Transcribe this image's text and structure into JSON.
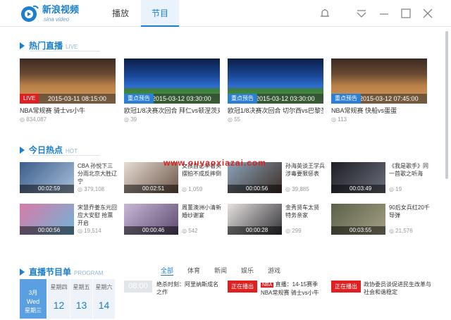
{
  "app": {
    "name": "新浪视频",
    "name_en": "sina video"
  },
  "tabs": [
    {
      "label": "播放"
    },
    {
      "label": "节目"
    }
  ],
  "live": {
    "title": "热门直播",
    "title_en": "LIVE",
    "cards": [
      {
        "badge": "LIVE",
        "time": "2015-03-11 08:15:00",
        "title": "NBA常规赛 骑士vs小牛",
        "count": "834,087"
      },
      {
        "badge": "重点预告",
        "time": "2015-03-12 03:30:00",
        "title": "欧冠1/8决赛次回合 拜仁vs顿涅茨克",
        "count": "39"
      },
      {
        "badge": "重点预告",
        "time": "2015-03-12 03:30:00",
        "title": "欧冠1/8决赛次回合 切尔西vs巴黎圣",
        "count": "55"
      },
      {
        "badge": "重点预告",
        "time": "2015-03-12 07:45:00",
        "title": "NBA常规赛 快船vs蛋蛋",
        "count": "113"
      }
    ]
  },
  "hot": {
    "title": "今日热点",
    "title_en": "HOT",
    "items": [
      {
        "duration": "00:02:59",
        "text": "CBA 孙悦下三分雨北京大胜辽宁",
        "count": "379,108"
      },
      {
        "duration": "00:02:51",
        "text": "女孩自己举着头摆拍不成反摔倒",
        "count": "1,059"
      },
      {
        "duration": "00:00:56",
        "text": "孙海英谈王学兵涉毒要狠惩表",
        "count": "39,885"
      },
      {
        "duration": "00:03:49",
        "text": "《我是歌手》同一首歌之听海",
        "count": "19"
      },
      {
        "duration": "00:00:56",
        "text": "宋慧乔姜东元回应大安慰 抢票开启",
        "count": "19,514"
      },
      {
        "duration": "00:00:46",
        "text": "周董澳洲小清新婚纱谢宴",
        "count": "542"
      },
      {
        "duration": "00:00:28",
        "text": "金秀贤车太贤 特务亲家",
        "count": "299"
      },
      {
        "duration": "00:03:55",
        "text": "90后女兵红20千导弹",
        "count": "21,576"
      }
    ]
  },
  "schedule": {
    "title": "直播节目单",
    "title_en": "PROGRAM",
    "month": "3月",
    "weekday_en": "Wed",
    "weekday": "星期三",
    "days": [
      {
        "name": "星期四",
        "num": "12"
      },
      {
        "name": "星期五",
        "num": "13"
      },
      {
        "name": "星期六",
        "num": "14"
      }
    ],
    "filters": [
      "全部",
      "体育",
      "新闻",
      "娱乐",
      "游戏"
    ],
    "time": "08:00",
    "programs": [
      {
        "text": "绝杀时刻：阿里纳斯成名之作"
      },
      {
        "onair": "正在播出",
        "tag": "NBA",
        "text": "直播：14-15赛季 NBA常规赛 骑士vs小牛"
      },
      {
        "onair": "正在播出",
        "text": "政协委员谈促进民生改革与社会和谐稳定"
      }
    ]
  },
  "watermark": "www.ouyaoxiazai.com"
}
